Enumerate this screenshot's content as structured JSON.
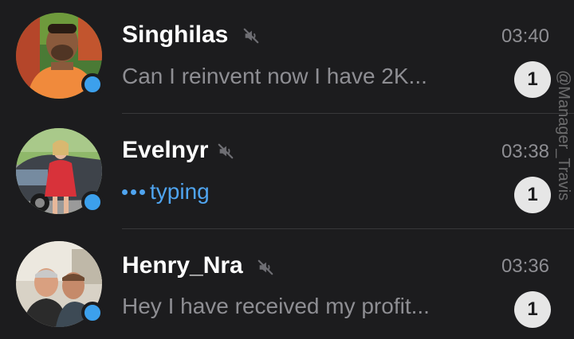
{
  "chats": [
    {
      "name": "Singhilas",
      "time": "03:40",
      "preview": "Can I reinvent now I have 2K...",
      "unread": "1",
      "muted": true,
      "online": true,
      "avatar": "person-orange-shirt"
    },
    {
      "name": "Evelnyr",
      "time": "03:38",
      "typing_label": "typing",
      "unread": "1",
      "muted": true,
      "online": true,
      "avatar": "woman-red-dress-car"
    },
    {
      "name": "Henry_Nra",
      "time": "03:36",
      "preview": "Hey I have received my profit...",
      "unread": "1",
      "muted": true,
      "online": true,
      "avatar": "two-men-selfie"
    }
  ],
  "watermark": "@Manager_Travis",
  "colors": {
    "background": "#1c1c1e",
    "online_dot": "#3ca0ec",
    "typing": "#4fa4ef",
    "secondary_text": "#8e8e93",
    "badge_bg": "#e6e6e6"
  },
  "icons": {
    "mute": "muted-speaker-icon",
    "online": "online-indicator-icon"
  }
}
